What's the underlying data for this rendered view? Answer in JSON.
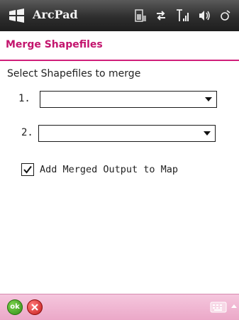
{
  "titlebar": {
    "app_title": "ArcPad",
    "icons": [
      "windows-start-icon",
      "battery-icon",
      "connectivity-icon",
      "signal-icon",
      "volume-icon",
      "close-ok-icon"
    ]
  },
  "dialog": {
    "title": "Merge Shapefiles",
    "prompt": "Select Shapefiles to merge",
    "fields": [
      {
        "label": "1.",
        "value": ""
      },
      {
        "label": "2.",
        "value": ""
      }
    ],
    "checkbox": {
      "label": "Add Merged Output to Map",
      "checked": true
    }
  },
  "commandbar": {
    "ok_label": "ok",
    "icons": [
      "ok-icon",
      "cancel-icon",
      "keyboard-icon"
    ]
  },
  "colors": {
    "accent": "#c3146d",
    "commandbar": "#eba8c8",
    "titlebar": "#2e2e2e"
  }
}
